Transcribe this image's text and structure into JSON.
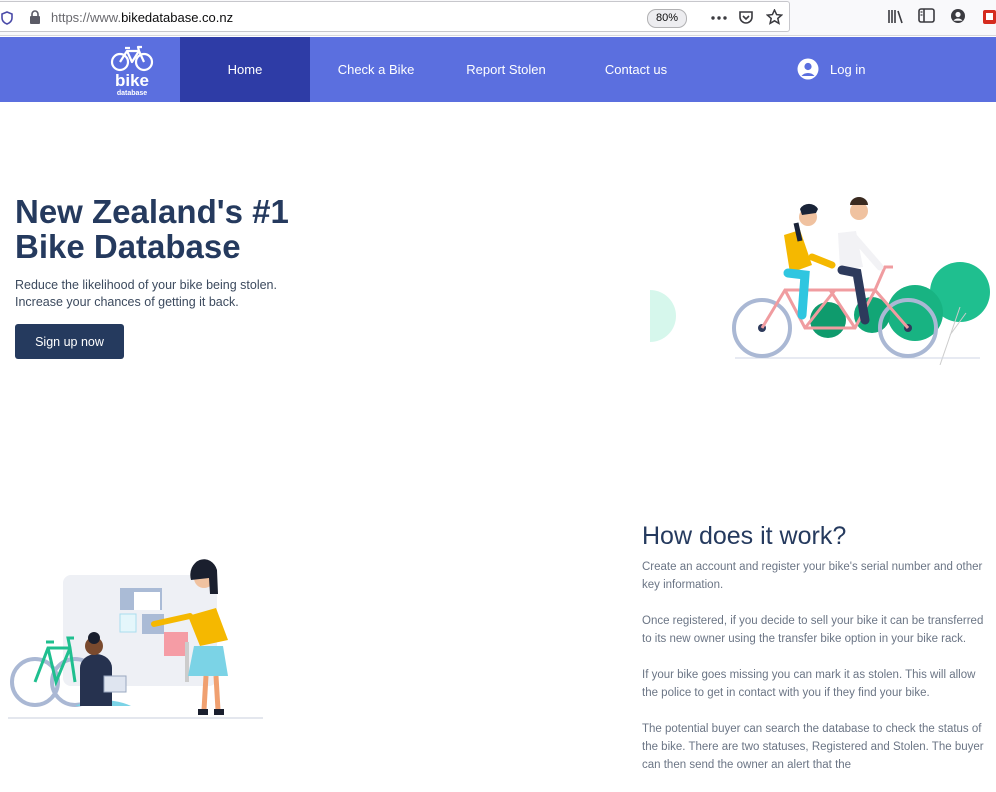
{
  "browser": {
    "url_prefix": "https://www.",
    "url_host": "bikedatabase.co.nz",
    "zoom": "80%",
    "icons": [
      "shield-icon",
      "lock-icon",
      "more-icon",
      "pocket-icon",
      "star-icon",
      "library-icon",
      "sidebar-icon",
      "account-icon",
      "extension-icon"
    ]
  },
  "nav": {
    "logo_word": "bike",
    "logo_sub": "database",
    "items": [
      {
        "label": "Home",
        "active": true
      },
      {
        "label": "Check a Bike"
      },
      {
        "label": "Report Stolen"
      },
      {
        "label": "Contact us"
      }
    ],
    "login_label": "Log in"
  },
  "hero": {
    "title_line1": "New Zealand's #1",
    "title_line2": "Bike Database",
    "subtitle_line1": "Reduce the likelihood of your bike being stolen.",
    "subtitle_line2": "Increase your chances of getting it back.",
    "cta": "Sign up now"
  },
  "how": {
    "title": "How does it work?",
    "paragraphs": [
      "Create an account and register your bike's serial number and other key information.",
      "Once registered, if you decide to sell your bike it can be transferred to its new owner using the transfer bike option in your bike rack.",
      "If your bike goes missing you can mark it as stolen. This will allow the police to get in contact with you if they find your bike.",
      "The potential buyer can search the database to check the status of the bike. There are two statuses, Registered and Stolen. The buyer can then send the owner an alert that the"
    ]
  },
  "colors": {
    "nav_bg": "#5b6fdf",
    "nav_active": "#2e3ca6",
    "heading": "#253a5e",
    "button": "#253a5e",
    "accent_green": "#1fbf8f"
  }
}
